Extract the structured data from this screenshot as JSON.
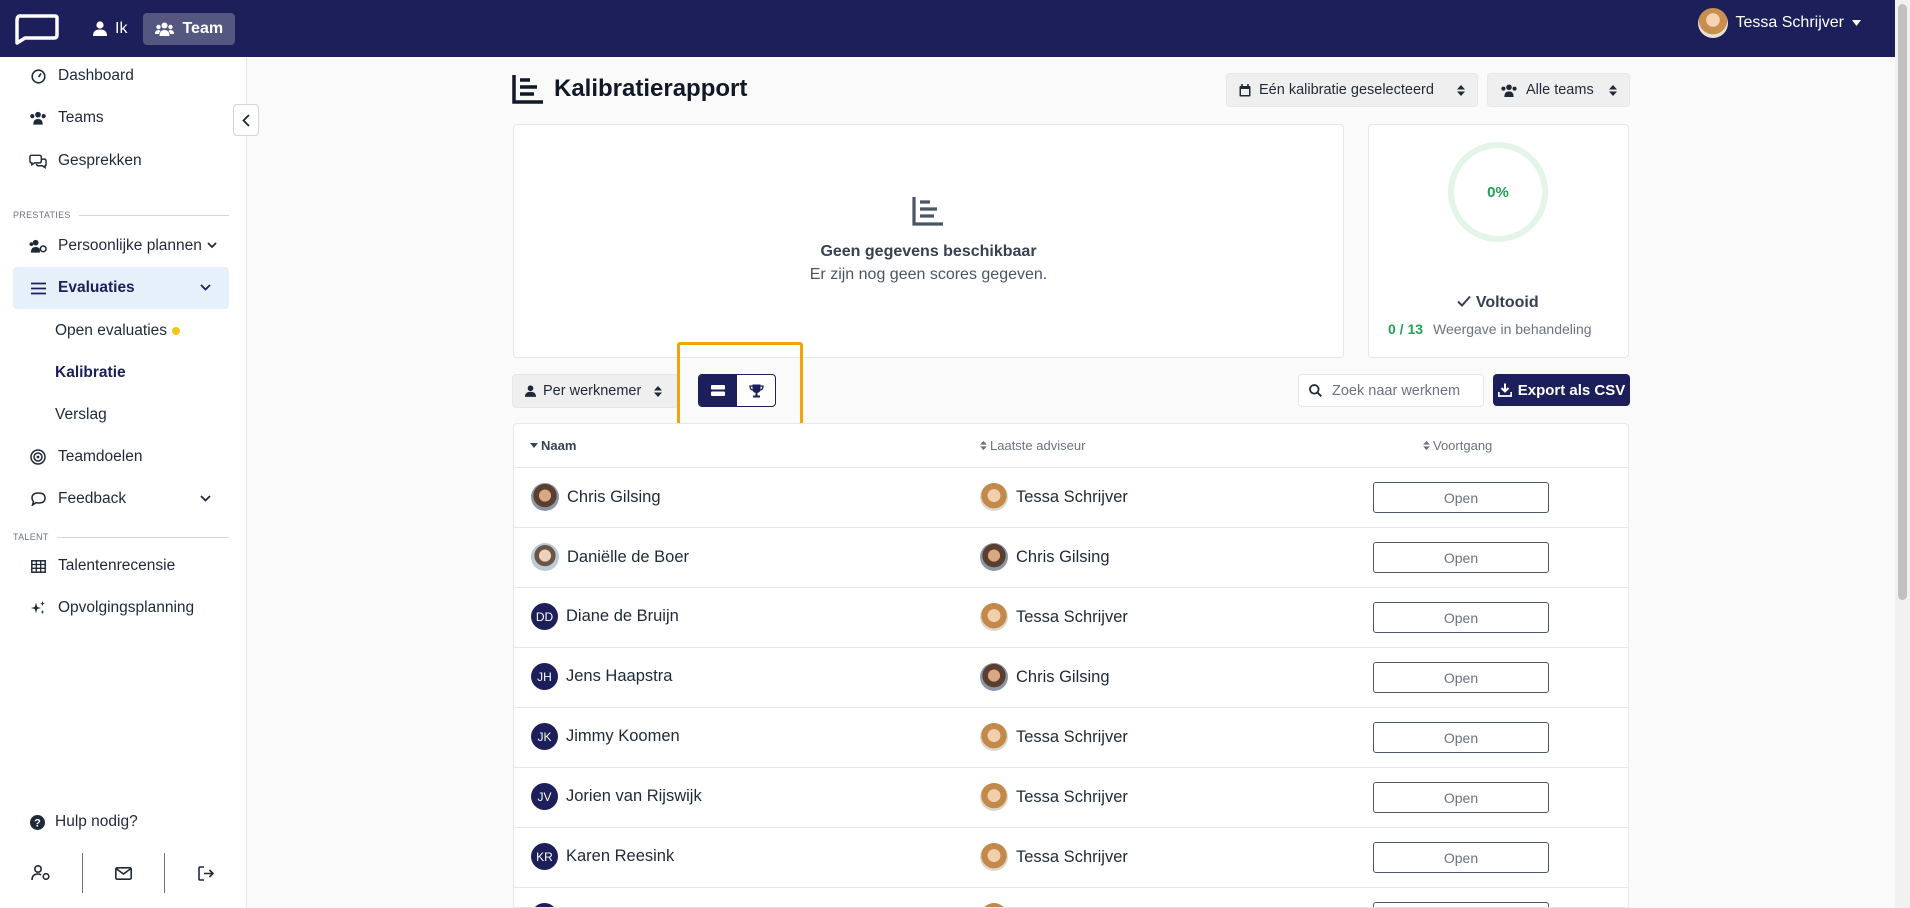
{
  "topbar": {
    "nav": [
      {
        "label": "Ik",
        "icon": "user-icon"
      },
      {
        "label": "Team",
        "icon": "users-icon",
        "active": true
      }
    ],
    "user_name": "Tessa Schrijver",
    "accent": "#1c1f5a"
  },
  "sidebar": {
    "items": [
      {
        "label": "Dashboard",
        "icon": "gauge-icon"
      },
      {
        "label": "Teams",
        "icon": "users-icon"
      },
      {
        "label": "Gesprekken",
        "icon": "chat-icon"
      }
    ],
    "section_prestaties": "PRESTATIES",
    "persoonlijke_plannen": "Persoonlijke plannen",
    "evaluaties": "Evaluaties",
    "sub_items": [
      "Open evaluaties",
      "Kalibratie",
      "Verslag"
    ],
    "teamdoelen": "Teamdoelen",
    "feedback": "Feedback",
    "section_talent": "TALENT",
    "talentenrecensie": "Talentenrecensie",
    "opvolgingsplanning": "Opvolgingsplanning",
    "help": "Hulp nodig?"
  },
  "header": {
    "title": "Kalibratierapport",
    "calibration_filter": "Eén kalibratie geselecteerd",
    "team_filter": "Alle teams"
  },
  "chart_card": {
    "empty_title": "Geen gegevens beschikbaar",
    "empty_sub": "Er zijn nog geen scores gegeven."
  },
  "progress_card": {
    "percent": "0%",
    "percent_value": 0,
    "status": "Voltooid",
    "count": "0 / 13",
    "count_label": "Weergave in behandeling"
  },
  "controls": {
    "group_by": "Per werknemer",
    "search_placeholder": "Zoek naar werknem",
    "export_label": "Export als CSV"
  },
  "table": {
    "columns": [
      "Naam",
      "Laatste adviseur",
      "Voortgang"
    ],
    "rows": [
      {
        "name": "Chris Gilsing",
        "avatar": "chris",
        "advisor": "Tessa Schrijver",
        "advisor_avatar": "tessa",
        "status": "Open"
      },
      {
        "name": "Daniëlle de Boer",
        "avatar": "danielle",
        "advisor": "Chris Gilsing",
        "advisor_avatar": "chris",
        "status": "Open"
      },
      {
        "name": "Diane de Bruijn",
        "initials": "DD",
        "advisor": "Tessa Schrijver",
        "advisor_avatar": "tessa",
        "status": "Open"
      },
      {
        "name": "Jens Haapstra",
        "initials": "JH",
        "advisor": "Chris Gilsing",
        "advisor_avatar": "chris",
        "status": "Open"
      },
      {
        "name": "Jimmy Koomen",
        "initials": "JK",
        "advisor": "Tessa Schrijver",
        "advisor_avatar": "tessa",
        "status": "Open"
      },
      {
        "name": "Jorien van Rijswijk",
        "initials": "JV",
        "advisor": "Tessa Schrijver",
        "advisor_avatar": "tessa",
        "status": "Open"
      },
      {
        "name": "Karen Reesink",
        "initials": "KR",
        "advisor": "Tessa Schrijver",
        "advisor_avatar": "tessa",
        "status": "Open"
      }
    ]
  }
}
